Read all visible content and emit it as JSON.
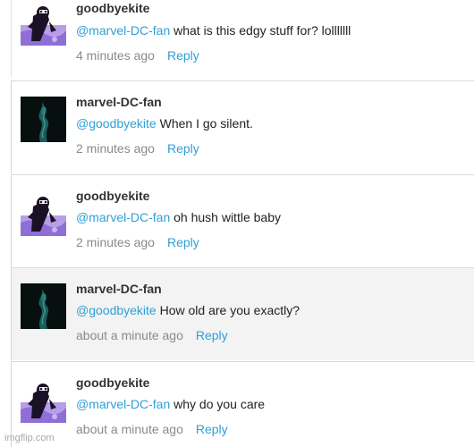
{
  "comments": [
    {
      "author": "goodbyekite",
      "mention": "@marvel-DC-fan",
      "text": " what is this edgy stuff for? lolllllll",
      "time": "4 minutes ago",
      "reply_label": "Reply",
      "avatar": "purple-character-avatar"
    },
    {
      "author": "marvel-DC-fan",
      "mention": "@goodbyekite",
      "text": " When I go silent.",
      "time": "2 minutes ago",
      "reply_label": "Reply",
      "avatar": "dark-smoke-avatar"
    },
    {
      "author": "goodbyekite",
      "mention": "@marvel-DC-fan",
      "text": " oh hush wittle baby",
      "time": "2 minutes ago",
      "reply_label": "Reply",
      "avatar": "purple-character-avatar"
    },
    {
      "author": "marvel-DC-fan",
      "mention": "@goodbyekite",
      "text": " How old are you exactly?",
      "time": "about a minute ago",
      "reply_label": "Reply",
      "avatar": "dark-smoke-avatar"
    },
    {
      "author": "goodbyekite",
      "mention": "@marvel-DC-fan",
      "text": " why do you care",
      "time": "about a minute ago",
      "reply_label": "Reply",
      "avatar": "purple-character-avatar"
    }
  ],
  "watermark": "imgflip.com",
  "colors": {
    "link": "#2f9fd6",
    "highlight_row": "#f3f3f3",
    "author": "#333333",
    "timestamp": "#8a8a8a"
  }
}
